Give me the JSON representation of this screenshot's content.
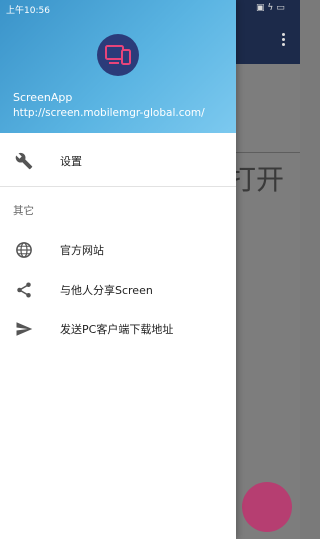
{
  "status_bar": {
    "time": "上午10:56"
  },
  "drawer": {
    "header": {
      "app_name": "ScreenApp",
      "url": "http://screen.mobilemgr-global.com/"
    },
    "menu": [
      {
        "label": "设置",
        "icon": "wrench-icon"
      }
    ],
    "section_title": "其它",
    "other_items": [
      {
        "label": "官方网站",
        "icon": "globe-icon"
      },
      {
        "label": "与他人分享Screen",
        "icon": "share-icon"
      },
      {
        "label": "发送PC客户端下载地址",
        "icon": "send-icon"
      }
    ]
  },
  "background_app": {
    "visible_text": "打开"
  },
  "colors": {
    "header_start": "#3a93c9",
    "header_end": "#7cc9ef",
    "avatar_bg": "#2b3b7a",
    "logo_accent": "#e8447a",
    "fab": "#c0336e"
  }
}
